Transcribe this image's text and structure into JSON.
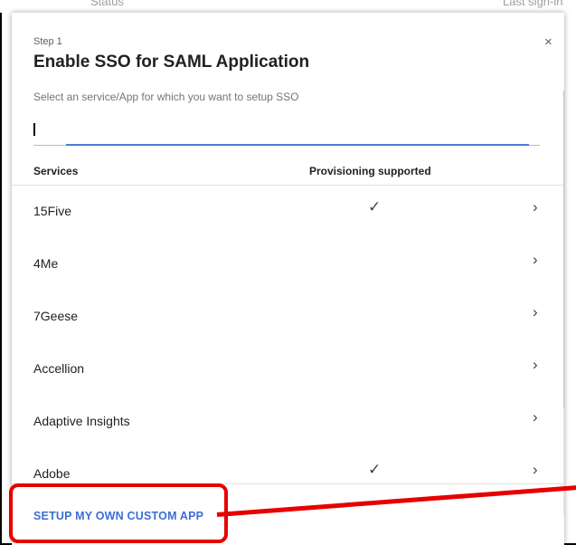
{
  "background": {
    "left_text": "Status",
    "right_text": "Last sign-in"
  },
  "dialog": {
    "step": "Step 1",
    "title": "Enable SSO for SAML Application",
    "close_glyph": "×",
    "subtitle": "Select an service/App for which you want to setup SSO",
    "search": {
      "value": "",
      "placeholder": ""
    },
    "columns": {
      "services": "Services",
      "provisioning": "Provisioning supported"
    },
    "rows": [
      {
        "name": "15Five",
        "check": "✓",
        "chevron": "›"
      },
      {
        "name": "4Me",
        "check": "",
        "chevron": "›"
      },
      {
        "name": "7Geese",
        "check": "",
        "chevron": "›"
      },
      {
        "name": "Accellion",
        "check": "",
        "chevron": "›"
      },
      {
        "name": "Adaptive Insights",
        "check": "",
        "chevron": "›"
      },
      {
        "name": "Adobe",
        "check": "✓",
        "chevron": "›"
      }
    ],
    "custom_app_label": "SETUP MY OWN CUSTOM APP"
  },
  "colors": {
    "accent": "#3b6fd6",
    "highlight": "#e60000",
    "focus_line": "#4a7bd0"
  }
}
